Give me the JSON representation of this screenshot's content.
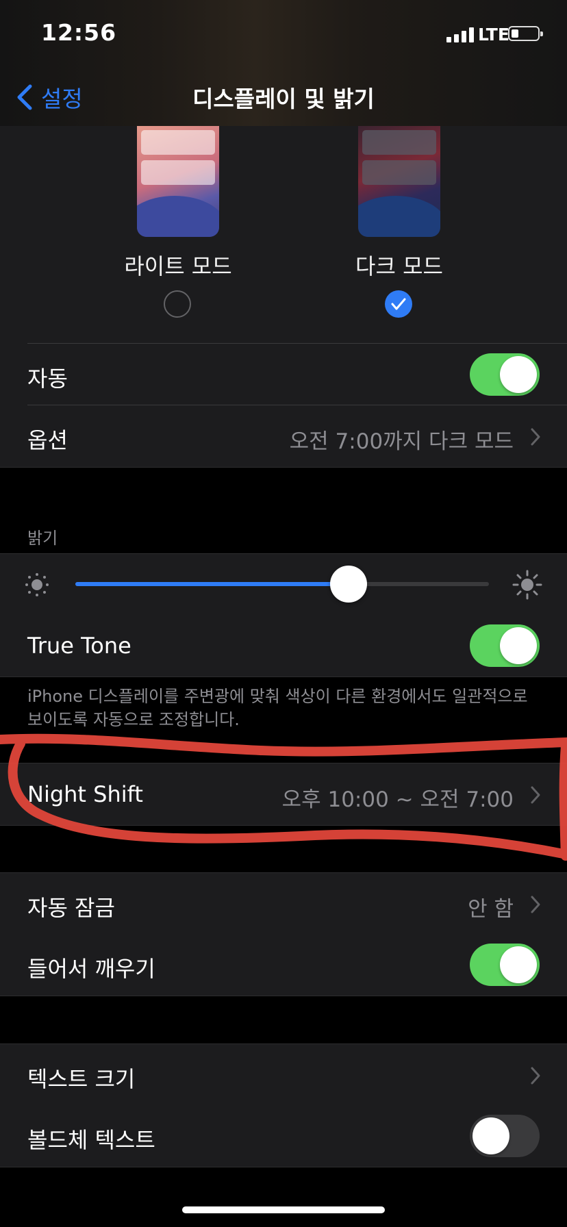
{
  "status_bar": {
    "time": "12:56",
    "network": "LTE"
  },
  "nav": {
    "back_label": "설정",
    "title": "디스플레이 및 밝기"
  },
  "appearance": {
    "light_label": "라이트 모드",
    "dark_label": "다크 모드",
    "selected": "dark"
  },
  "rows": {
    "automatic": {
      "label": "자동",
      "toggle_on": true
    },
    "options": {
      "label": "옵션",
      "value": "오전 7:00까지 다크 모드"
    }
  },
  "brightness": {
    "header": "밝기",
    "level_percent": 66
  },
  "true_tone": {
    "label": "True Tone",
    "toggle_on": true,
    "footer": "iPhone 디스플레이를 주변광에 맞춰 색상이 다른 환경에서도 일관적으로 보이도록 자동으로 조정합니다."
  },
  "night_shift": {
    "label": "Night Shift",
    "value": "오후 10:00 ~ 오전 7:00"
  },
  "auto_lock": {
    "label": "자동 잠금",
    "value": "안 함"
  },
  "raise_to_wake": {
    "label": "들어서 깨우기",
    "toggle_on": true
  },
  "text_size": {
    "label": "텍스트 크기"
  },
  "bold_text": {
    "label": "볼드체 텍스트",
    "toggle_on": false
  },
  "colors": {
    "accent": "#2f7cf6",
    "toggle_on": "#5bd35f",
    "annotation": "#e0463a"
  }
}
